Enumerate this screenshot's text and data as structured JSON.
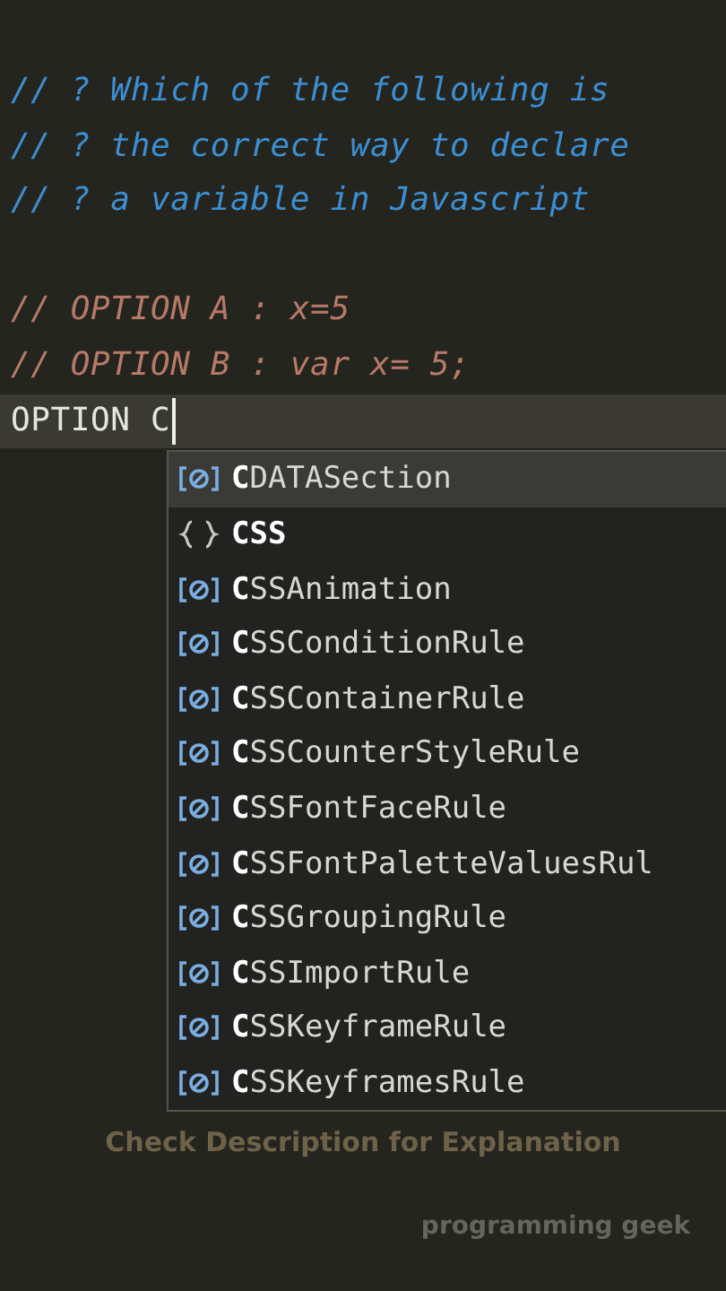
{
  "editor": {
    "lines": [
      {
        "kind": "question",
        "text": "// ? Which of the following is"
      },
      {
        "kind": "question",
        "text": "// ? the correct way to declare"
      },
      {
        "kind": "question",
        "text": "// ? a variable in Javascript"
      },
      {
        "kind": "blank"
      },
      {
        "kind": "option",
        "text": "// OPTION A : x=5"
      },
      {
        "kind": "option",
        "text": "// OPTION B : var x= 5;"
      },
      {
        "kind": "current",
        "text": "OPTION C"
      }
    ]
  },
  "suggestions": [
    {
      "kind": "variable",
      "label": "**C**DATASection",
      "selected": true
    },
    {
      "kind": "module",
      "label": "**CSS**",
      "selected": false
    },
    {
      "kind": "variable",
      "label": "**C**SSAnimation",
      "selected": false
    },
    {
      "kind": "variable",
      "label": "**C**SSConditionRule",
      "selected": false
    },
    {
      "kind": "variable",
      "label": "**C**SSContainerRule",
      "selected": false
    },
    {
      "kind": "variable",
      "label": "**C**SSCounterStyleRule",
      "selected": false
    },
    {
      "kind": "variable",
      "label": "**C**SSFontFaceRule",
      "selected": false
    },
    {
      "kind": "variable",
      "label": "**C**SSFontPaletteValuesRul",
      "selected": false
    },
    {
      "kind": "variable",
      "label": "**C**SSGroupingRule",
      "selected": false
    },
    {
      "kind": "variable",
      "label": "**C**SSImportRule",
      "selected": false
    },
    {
      "kind": "variable",
      "label": "**C**SSKeyframeRule",
      "selected": false
    },
    {
      "kind": "variable",
      "label": "**C**SSKeyframesRule",
      "selected": false
    }
  ],
  "caption": "Check Description for Explanation",
  "credit": "programming geek"
}
